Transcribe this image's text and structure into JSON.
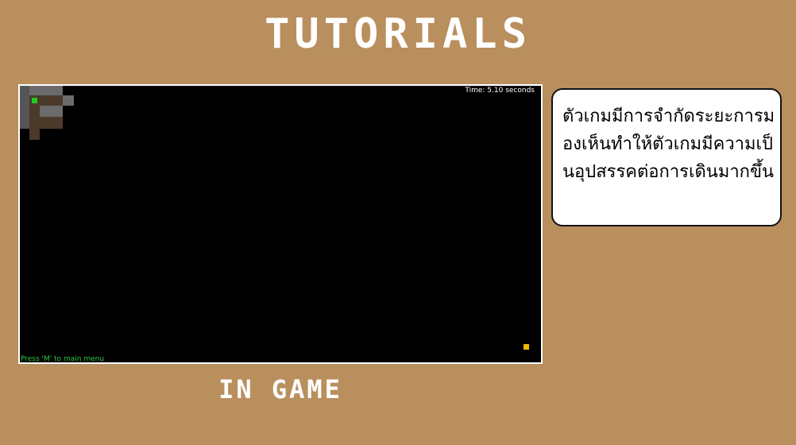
{
  "title": "TUTORIALS",
  "caption": "IN GAME",
  "game": {
    "hud_time": "Time: 5.10 seconds",
    "hud_hint": "Press 'M' to main menu",
    "colors": {
      "background": "#000000",
      "border": "#ffffff",
      "floor_light": "#6e6e6e",
      "floor_dark": "#4a3a2a",
      "player": "#22cc22",
      "goal": "#f5b800",
      "hint_text": "#2ecc40"
    }
  },
  "bubble": {
    "text": "ตัวเกมมีการจำกัดระยะการมองเห็นทำให้ตัวเกมมีความเป็นอุปสรรคต่อการเดินมากขึ้น"
  },
  "page_background": "#b98f5e"
}
